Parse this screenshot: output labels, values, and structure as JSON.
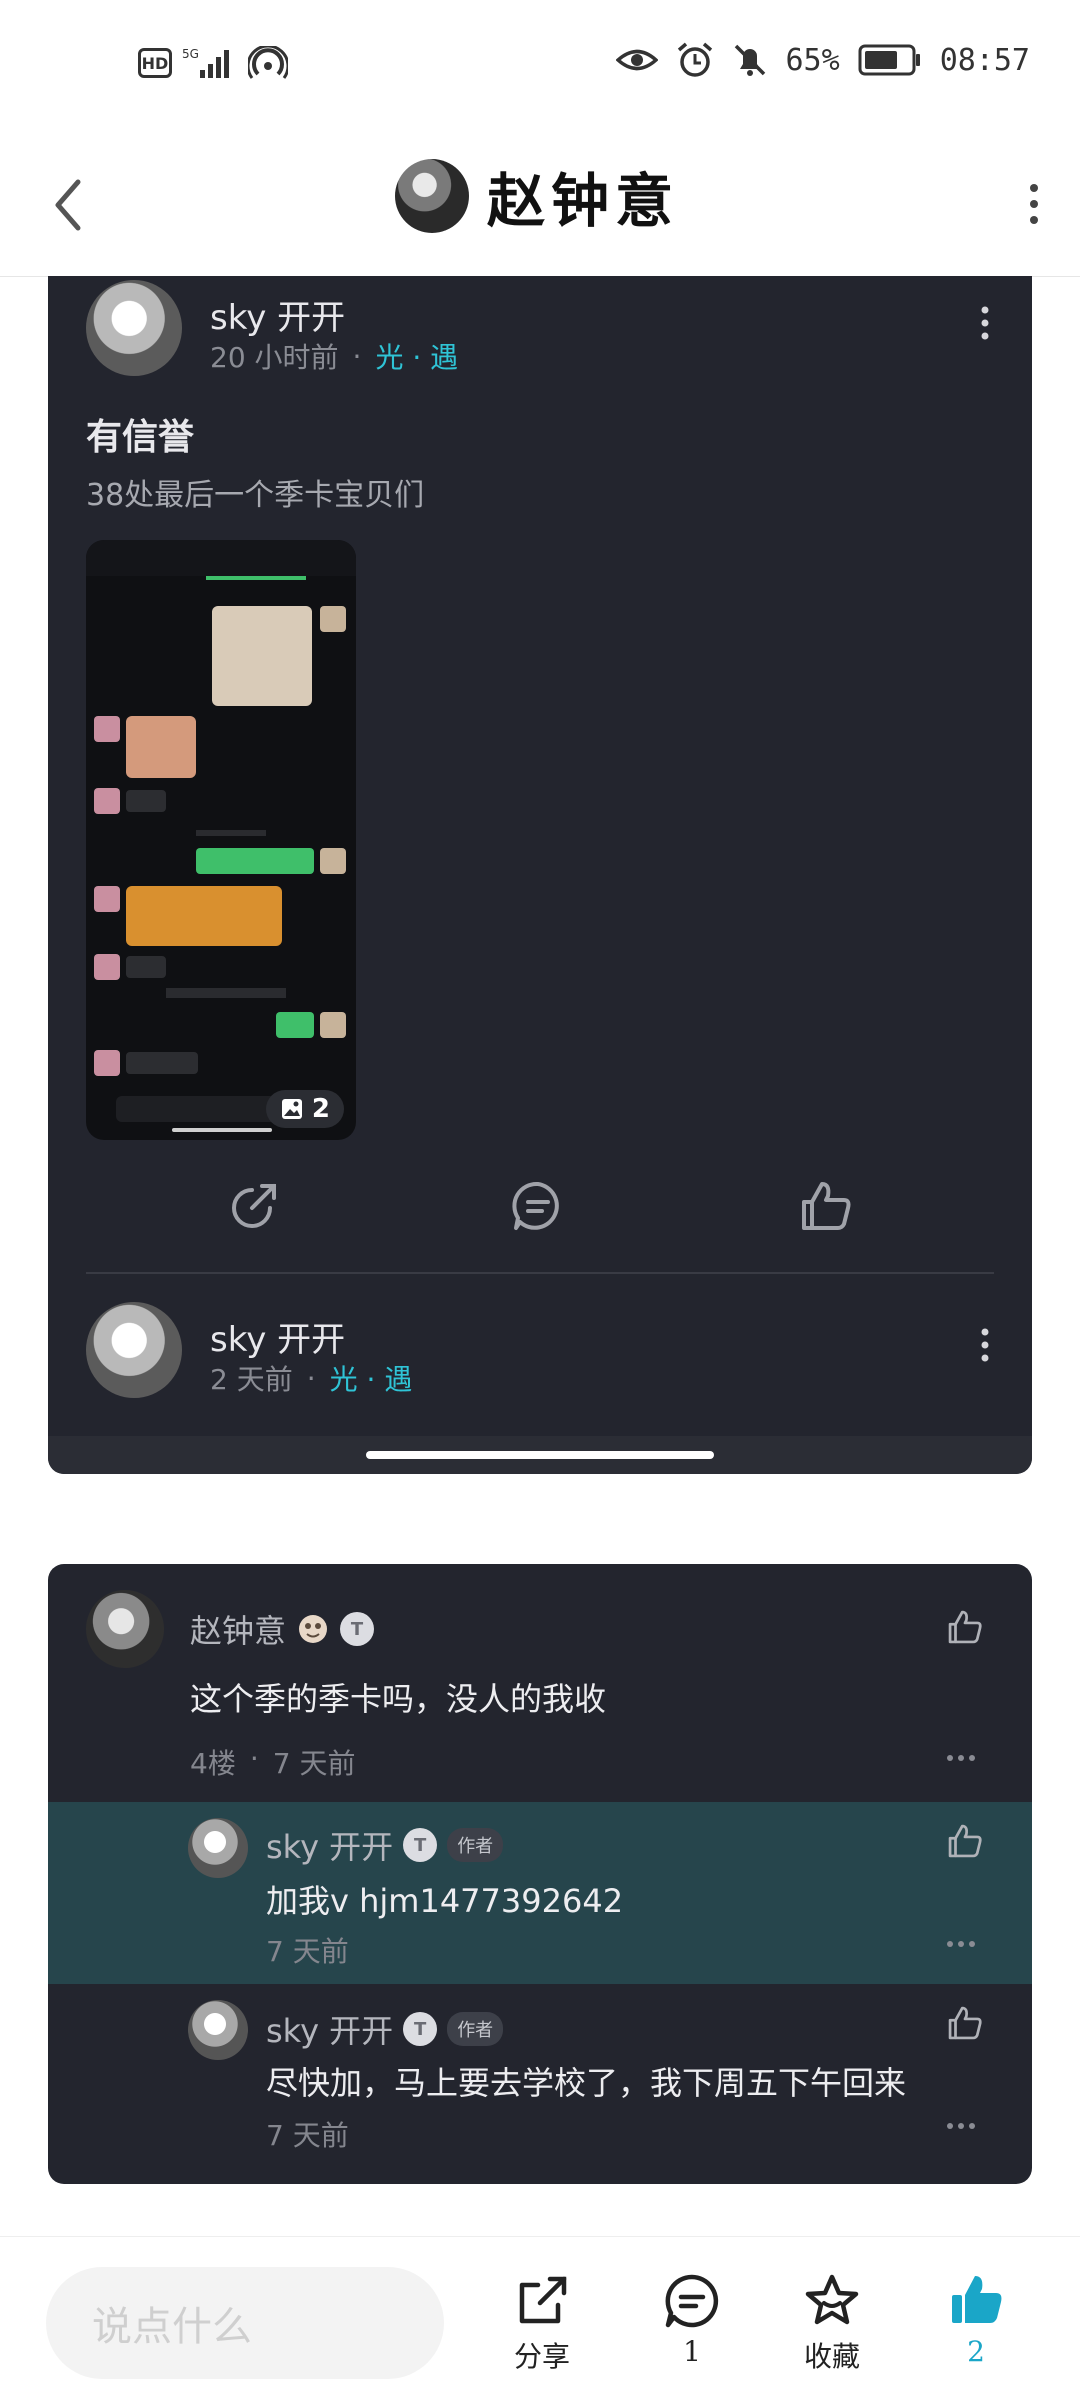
{
  "status": {
    "left_badge": "HD",
    "network": "5G",
    "battery": "65%",
    "time": "08:57"
  },
  "header": {
    "title": "赵钟意",
    "back_icon": "chevron-left-icon",
    "menu_icon": "vertical-dots-icon"
  },
  "post": {
    "username": "sky 开开",
    "time": "20 小时前",
    "separator": "·",
    "tag": "光 · 遇",
    "title": "有信誉",
    "body": "38处最后一个季卡宝贝们",
    "image_count": "2",
    "actions": [
      "share-icon",
      "comment-icon",
      "like-icon"
    ]
  },
  "post2": {
    "username": "sky 开开",
    "time": "2 天前",
    "separator": "·",
    "tag": "光 · 遇"
  },
  "comments": {
    "main": {
      "username": "赵钟意",
      "badge": "T",
      "text": "这个季的季卡吗，没人的我收",
      "floor": "4楼",
      "separator": "·",
      "time": "7 天前"
    },
    "replies": [
      {
        "username": "sky 开开",
        "badge": "T",
        "author_tag": "作者",
        "text": "加我v hjm1477392642",
        "time": "7 天前"
      },
      {
        "username": "sky 开开",
        "badge": "T",
        "author_tag": "作者",
        "text": "尽快加，马上要去学校了，我下周五下午回来",
        "time": "7 天前"
      }
    ]
  },
  "bottom_bar": {
    "placeholder": "说点什么",
    "share_label": "分享",
    "comment_count": "1",
    "collect_label": "收藏",
    "like_count": "2",
    "accent": "#1aa6c8"
  }
}
